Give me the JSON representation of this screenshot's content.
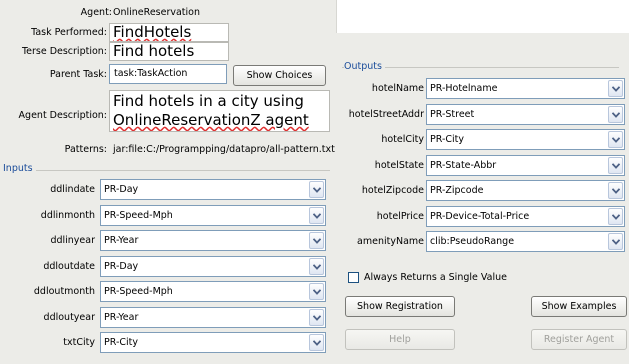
{
  "agent": {
    "label": "Agent:",
    "value": "OnlineReservation"
  },
  "task_performed": {
    "label": "Task Performed:",
    "value": "FindHotels"
  },
  "terse_description": {
    "label": "Terse Description:",
    "value": "Find hotels"
  },
  "parent_task": {
    "label": "Parent Task:",
    "value": "task:TaskAction",
    "button": "Show Choices"
  },
  "agent_description": {
    "label": "Agent Description:",
    "line1": "Find hotels in a city using",
    "line2": "OnlineReservationZ agent"
  },
  "patterns": {
    "label": "Patterns:",
    "value": "jar:file:C:/Programpping/datapro/all-pattern.txt"
  },
  "inputs": {
    "title": "Inputs",
    "rows": [
      {
        "label": "ddlindate",
        "value": "PR-Day"
      },
      {
        "label": "ddlinmonth",
        "value": "PR-Speed-Mph"
      },
      {
        "label": "ddlinyear",
        "value": "PR-Year"
      },
      {
        "label": "ddloutdate",
        "value": "PR-Day"
      },
      {
        "label": "ddloutmonth",
        "value": "PR-Speed-Mph"
      },
      {
        "label": "ddloutyear",
        "value": "PR-Year"
      },
      {
        "label": "txtCity",
        "value": "PR-City"
      }
    ]
  },
  "outputs": {
    "title": "Outputs",
    "rows": [
      {
        "label": "hotelName",
        "value": "PR-Hotelname"
      },
      {
        "label": "hotelStreetAddr",
        "value": "PR-Street"
      },
      {
        "label": "hotelCity",
        "value": "PR-City"
      },
      {
        "label": "hotelState",
        "value": "PR-State-Abbr"
      },
      {
        "label": "hotelZipcode",
        "value": "PR-Zipcode"
      },
      {
        "label": "hotelPrice",
        "value": "PR-Device-Total-Price"
      },
      {
        "label": "amenityName",
        "value": "clib:PseudoRange"
      }
    ]
  },
  "single_value_checkbox": {
    "label": "Always Returns a Single Value",
    "checked": false
  },
  "buttons": {
    "show_registration": "Show Registration",
    "show_examples": "Show Examples",
    "help": "Help",
    "register_agent": "Register Agent"
  },
  "icons": {
    "combo_arrow": "chevron-down-icon"
  },
  "colors": {
    "group_title": "#1a4c9a",
    "panel_bg": "#ecece8",
    "field_border": "#7f9db9"
  }
}
